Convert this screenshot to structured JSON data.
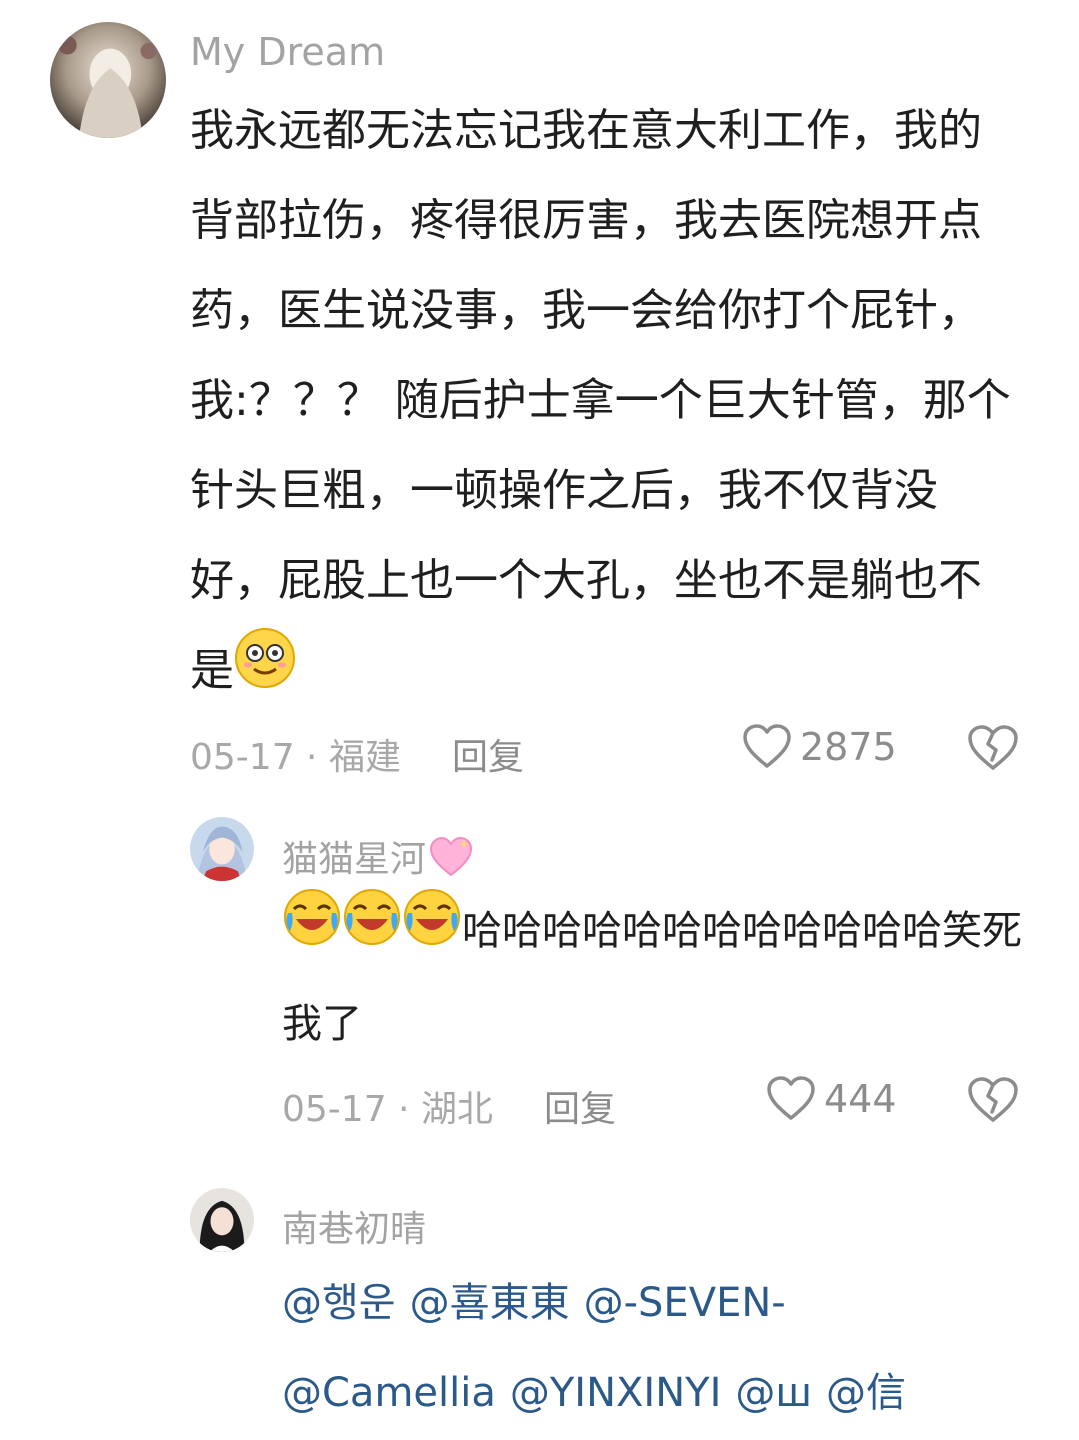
{
  "comments": [
    {
      "username": "My Dream",
      "text": "我永远都无法忘记我在意大利工作，我的背部拉伤，疼得很厉害，我去医院想开点药，医生说没事，我一会给你打个屁针，我:？？？  随后护士拿一个巨大针管，那个针头巨粗，一顿操作之后，我不仅背没好，屁股上也一个大孔，坐也不是躺也不是",
      "emoji_trailing": "dazed-face-emoji",
      "date_location": "05-17 · 福建",
      "reply_label": "回复",
      "like_count": "2875"
    },
    {
      "username": "猫猫星河",
      "username_emoji": "sparkling-heart-emoji",
      "leading_emojis": [
        "laugh-cry-emoji",
        "laugh-cry-emoji",
        "laugh-cry-emoji"
      ],
      "text": "哈哈哈哈哈哈哈哈哈哈哈哈笑死我了",
      "date_location": "05-17 · 湖北",
      "reply_label": "回复",
      "like_count": "444"
    },
    {
      "username": "南巷初晴",
      "mentions": [
        "@행운",
        "@喜東東",
        "@-SEVEN-",
        "@Camellia",
        "@YINXINYI",
        "@ш",
        "@信"
      ]
    }
  ],
  "colors": {
    "username": "#a3a3a3",
    "meta": "#a8a8a8",
    "icon": "#8c8c8c",
    "mention": "#2b5a8a",
    "text": "#1f1f1f"
  }
}
